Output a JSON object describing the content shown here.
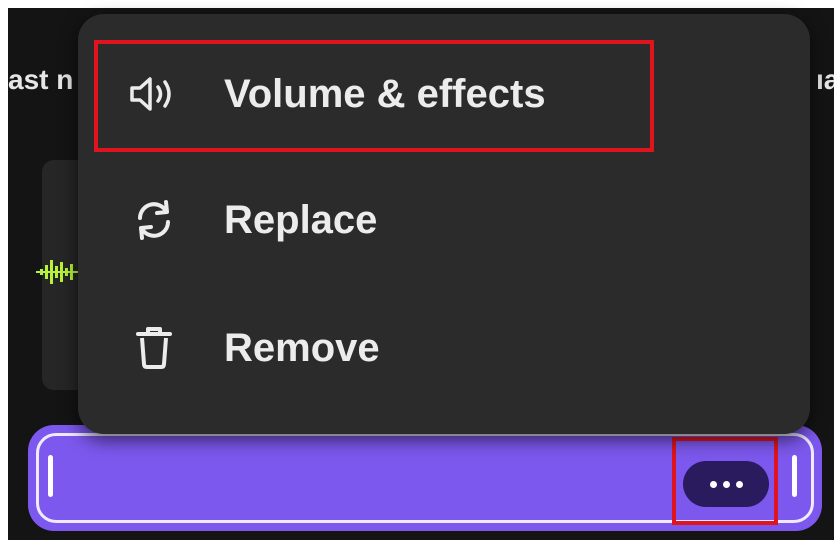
{
  "background": {
    "left_label": "ast n",
    "right_label": "ıa"
  },
  "menu": {
    "items": [
      {
        "label": "Volume & effects",
        "icon": "speaker-icon"
      },
      {
        "label": "Replace",
        "icon": "refresh-icon"
      },
      {
        "label": "Remove",
        "icon": "trash-icon"
      }
    ]
  },
  "clip": {
    "more_button_icon": "more-dots-icon"
  },
  "colors": {
    "menu_bg": "#2b2b2b",
    "clip_purple": "#7d58ee",
    "highlight_red": "#e0141e",
    "waveform_green": "#b8f23a"
  }
}
